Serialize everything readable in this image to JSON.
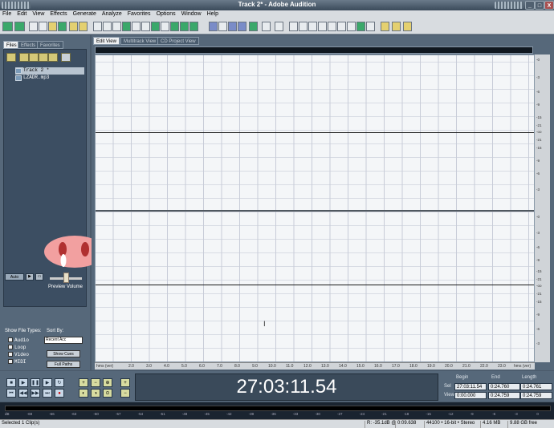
{
  "window": {
    "title": "Track 2* - Adobe Audition",
    "min": "_",
    "max": "□",
    "close": "X"
  },
  "menu": [
    "File",
    "Edit",
    "View",
    "Effects",
    "Generate",
    "Analyze",
    "Favorites",
    "Options",
    "Window",
    "Help"
  ],
  "left": {
    "tabs": [
      "Files",
      "Effects",
      "Favorites"
    ],
    "files": [
      "Track 2 *",
      "LZADR.mp3"
    ],
    "autoplay": "Auto",
    "loop_btn": "▶",
    "small": "▭",
    "preview_volume": "Preview Volume",
    "show_file_types": "Show File Types:",
    "sort_by": "Sort By:",
    "sort_value": "Recent Acc",
    "types": [
      "Audio",
      "Loop",
      "Video",
      "MIDI"
    ],
    "show_cues": "Show Cues",
    "full_paths": "Full Paths"
  },
  "views": [
    "Edit View",
    "Multitrack View",
    "CD Project View"
  ],
  "ruler_top": [
    "-0",
    "-3",
    "-6",
    "-9",
    "-15",
    "-21",
    "-oo",
    "-21",
    "-15",
    "-9",
    "-6",
    "-3"
  ],
  "ruler_bottom": [
    "-0",
    "-3",
    "-6",
    "-9",
    "-15",
    "-21",
    "-oo",
    "-21",
    "-15",
    "-9",
    "-6",
    "-3"
  ],
  "timeline": [
    "hms (ver)",
    "2.0",
    "4.0",
    "6.0",
    "8.0",
    "10.0",
    "12.0",
    "14.0",
    "16.0",
    "18.0",
    "20.0",
    "22.0",
    "hms (ver)"
  ],
  "timeline_extra": [
    "3.0",
    "5.0",
    "7.0",
    "9.0",
    "11.0",
    "13.0",
    "15.0",
    "17.0",
    "19.0",
    "21.0",
    "23.0"
  ],
  "time": "27:03:11.54",
  "selview": {
    "begin": "Begin",
    "end": "End",
    "length": "Length",
    "sel": "Sel",
    "view": "View",
    "sel_begin": "27:03:11.54",
    "sel_end": "0:24.760",
    "sel_len": "0:24.761",
    "view_begin": "0:00.000",
    "view_end": "0:24.759",
    "view_len": "0:24.759"
  },
  "meter_labels": [
    "dB",
    "-69",
    "-66",
    "-63",
    "-60",
    "-57",
    "-54",
    "-51",
    "-48",
    "-45",
    "-42",
    "-39",
    "-36",
    "-33",
    "-30",
    "-27",
    "-24",
    "-21",
    "-18",
    "-15",
    "-12",
    "-9",
    "-6",
    "-3",
    "0"
  ],
  "status": {
    "left": "Selected 1 Clip(s)",
    "r": "R: -35.1dB @",
    "pos": "0:09.638",
    "fmt": "44100 • 16-bit • Stereo",
    "size": "4.16 MB",
    "free": "9.88 GB free"
  },
  "colors": {
    "panel": "#56687a",
    "wave_bg": "#f4f6f8",
    "title": "#3a4a5a"
  }
}
